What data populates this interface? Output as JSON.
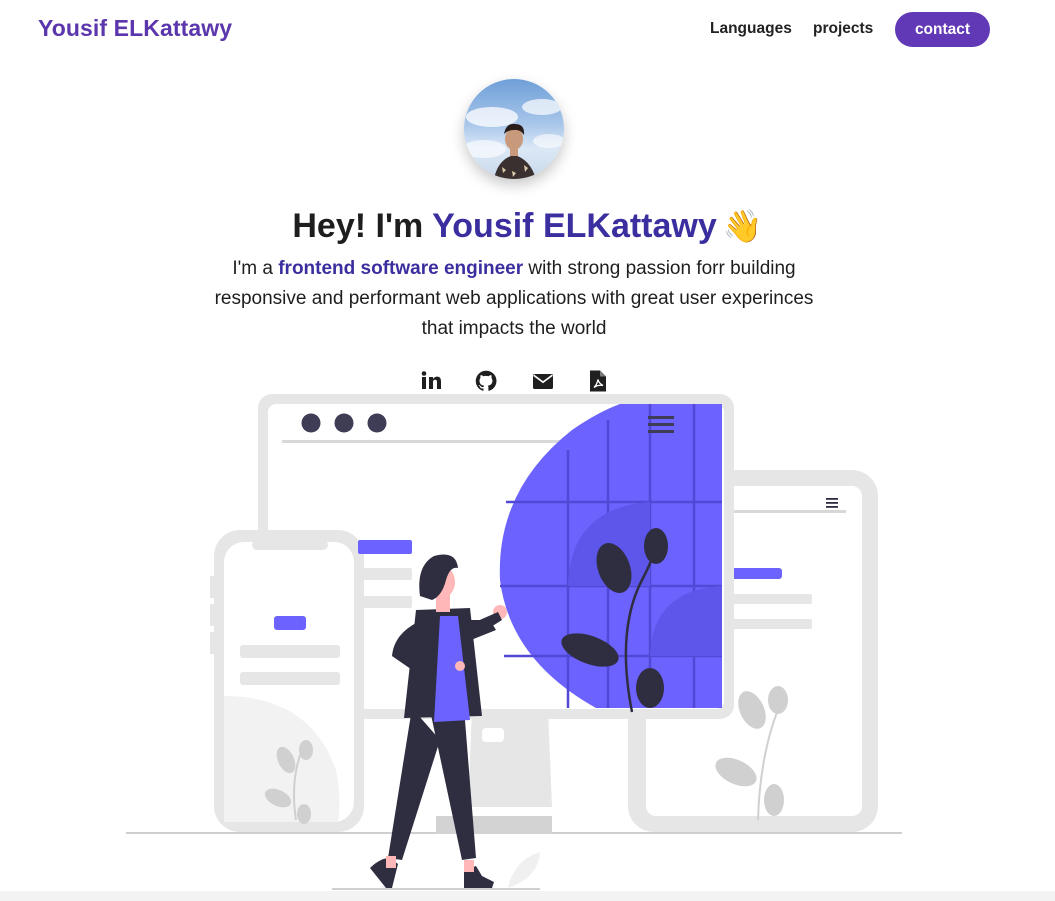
{
  "nav": {
    "brand": "Yousif ELKattawy",
    "links": [
      "Languages",
      "projects"
    ],
    "contact_label": "contact"
  },
  "hero": {
    "title_prefix": "Hey! I'm ",
    "title_name": "Yousif ELKattawy",
    "wave_emoji": "👋",
    "desc_prefix": "I'm a ",
    "desc_highlight": "frontend software engineer",
    "desc_rest": " with strong passion forr building responsive and performant web applications with great user experinces that impacts the world"
  },
  "socials": [
    "linkedin-icon",
    "github-icon",
    "envelope-icon",
    "pdf-file-icon"
  ],
  "colors": {
    "brand": "#5b36ad",
    "accent": "#6c63ff",
    "dark": "#2f2e41",
    "light_gray": "#e6e6e6"
  }
}
